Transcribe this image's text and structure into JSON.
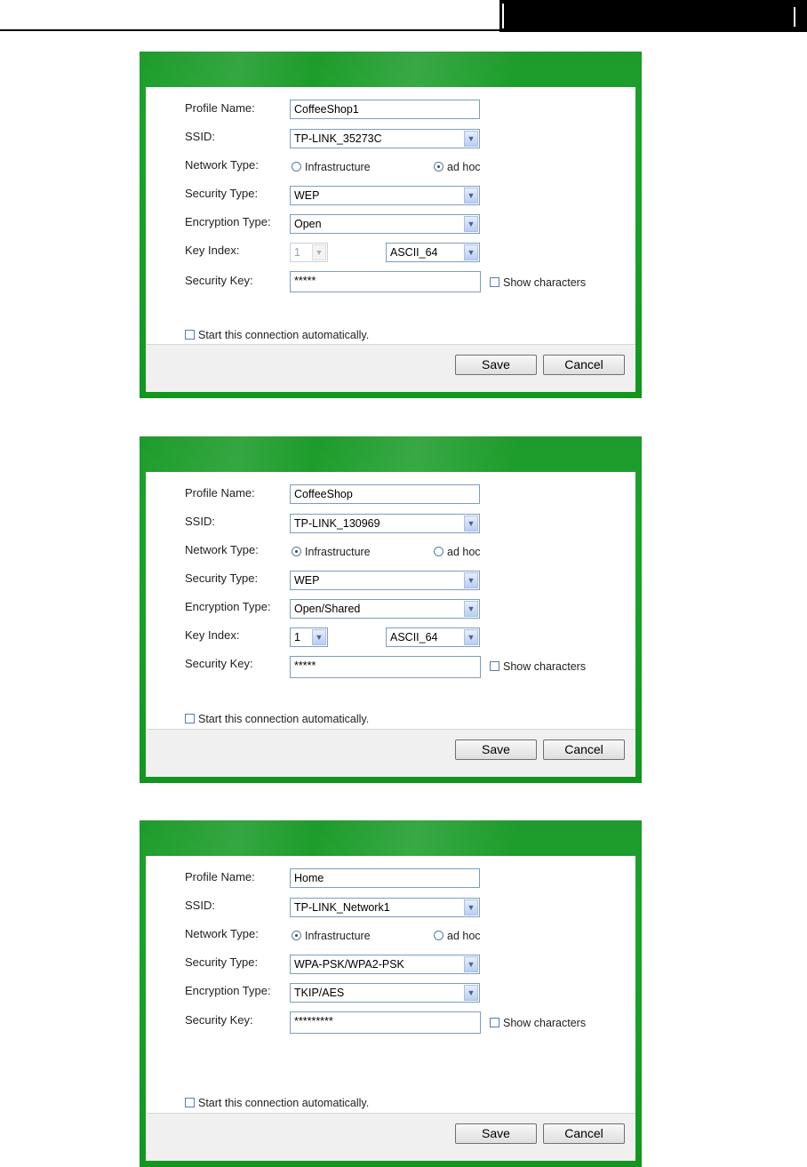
{
  "dialogs": [
    {
      "labels": {
        "profile_name": "Profile Name:",
        "ssid": "SSID:",
        "network_type": "Network Type:",
        "security_type": "Security Type:",
        "encryption_type": "Encryption Type:",
        "key_index": "Key Index:",
        "security_key": "Security Key:"
      },
      "profile_name": "CoffeeShop1",
      "ssid": "TP-LINK_35273C",
      "network_type": {
        "infrastructure": "Infrastructure",
        "adhoc": "ad hoc",
        "selected": "ad hoc"
      },
      "security_type": "WEP",
      "encryption_type": "Open",
      "key_index": "1",
      "key_format": "ASCII_64",
      "security_key": "*****",
      "show_characters": "Show characters",
      "start_auto": "Start this connection automatically.",
      "save": "Save",
      "cancel": "Cancel"
    },
    {
      "labels": {
        "profile_name": "Profile Name:",
        "ssid": "SSID:",
        "network_type": "Network Type:",
        "security_type": "Security Type:",
        "encryption_type": "Encryption Type:",
        "key_index": "Key Index:",
        "security_key": "Security Key:"
      },
      "profile_name": "CoffeeShop",
      "ssid": "TP-LINK_130969",
      "network_type": {
        "infrastructure": "Infrastructure",
        "adhoc": "ad hoc",
        "selected": "Infrastructure"
      },
      "security_type": "WEP",
      "encryption_type": "Open/Shared",
      "key_index": "1",
      "key_format": "ASCII_64",
      "security_key": "*****",
      "show_characters": "Show characters",
      "start_auto": "Start this connection automatically.",
      "save": "Save",
      "cancel": "Cancel"
    },
    {
      "labels": {
        "profile_name": "Profile Name:",
        "ssid": "SSID:",
        "network_type": "Network Type:",
        "security_type": "Security Type:",
        "encryption_type": "Encryption Type:",
        "security_key": "Security Key:"
      },
      "profile_name": "Home",
      "ssid": "TP-LINK_Network1",
      "network_type": {
        "infrastructure": "Infrastructure",
        "adhoc": "ad hoc",
        "selected": "Infrastructure"
      },
      "security_type": "WPA-PSK/WPA2-PSK",
      "encryption_type": "TKIP/AES",
      "security_key": "*********",
      "show_characters": "Show characters",
      "start_auto": "Start this connection automatically.",
      "save": "Save",
      "cancel": "Cancel"
    }
  ],
  "icons": {
    "dropdown": "chevron-down-icon"
  }
}
